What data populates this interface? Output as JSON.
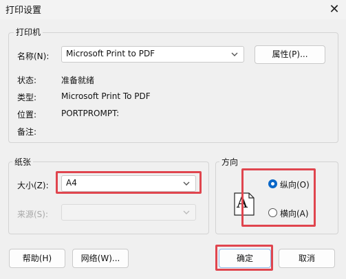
{
  "window": {
    "title": "打印设置",
    "close_label": "✕"
  },
  "printer": {
    "legend": "打印机",
    "name_label": "名称(N):",
    "name_value": "Microsoft Print to PDF",
    "properties_label": "属性(P)...",
    "status_label": "状态:",
    "status_value": "准备就绪",
    "type_label": "类型:",
    "type_value": "Microsoft Print To PDF",
    "where_label": "位置:",
    "where_value": "PORTPROMPT:",
    "comment_label": "备注:",
    "comment_value": ""
  },
  "paper": {
    "legend": "纸张",
    "size_label": "大小(Z):",
    "size_value": "A4",
    "source_label": "来源(S):",
    "source_value": ""
  },
  "orientation": {
    "legend": "方向",
    "preview_glyph": "A",
    "portrait_label": "纵向(O)",
    "landscape_label": "横向(A)",
    "selected": "portrait"
  },
  "footer": {
    "help_label": "帮助(H)",
    "network_label": "网络(W)...",
    "ok_label": "确定",
    "cancel_label": "取消"
  },
  "colors": {
    "highlight": "#e0454e",
    "radio_accent": "#0a67c8"
  }
}
